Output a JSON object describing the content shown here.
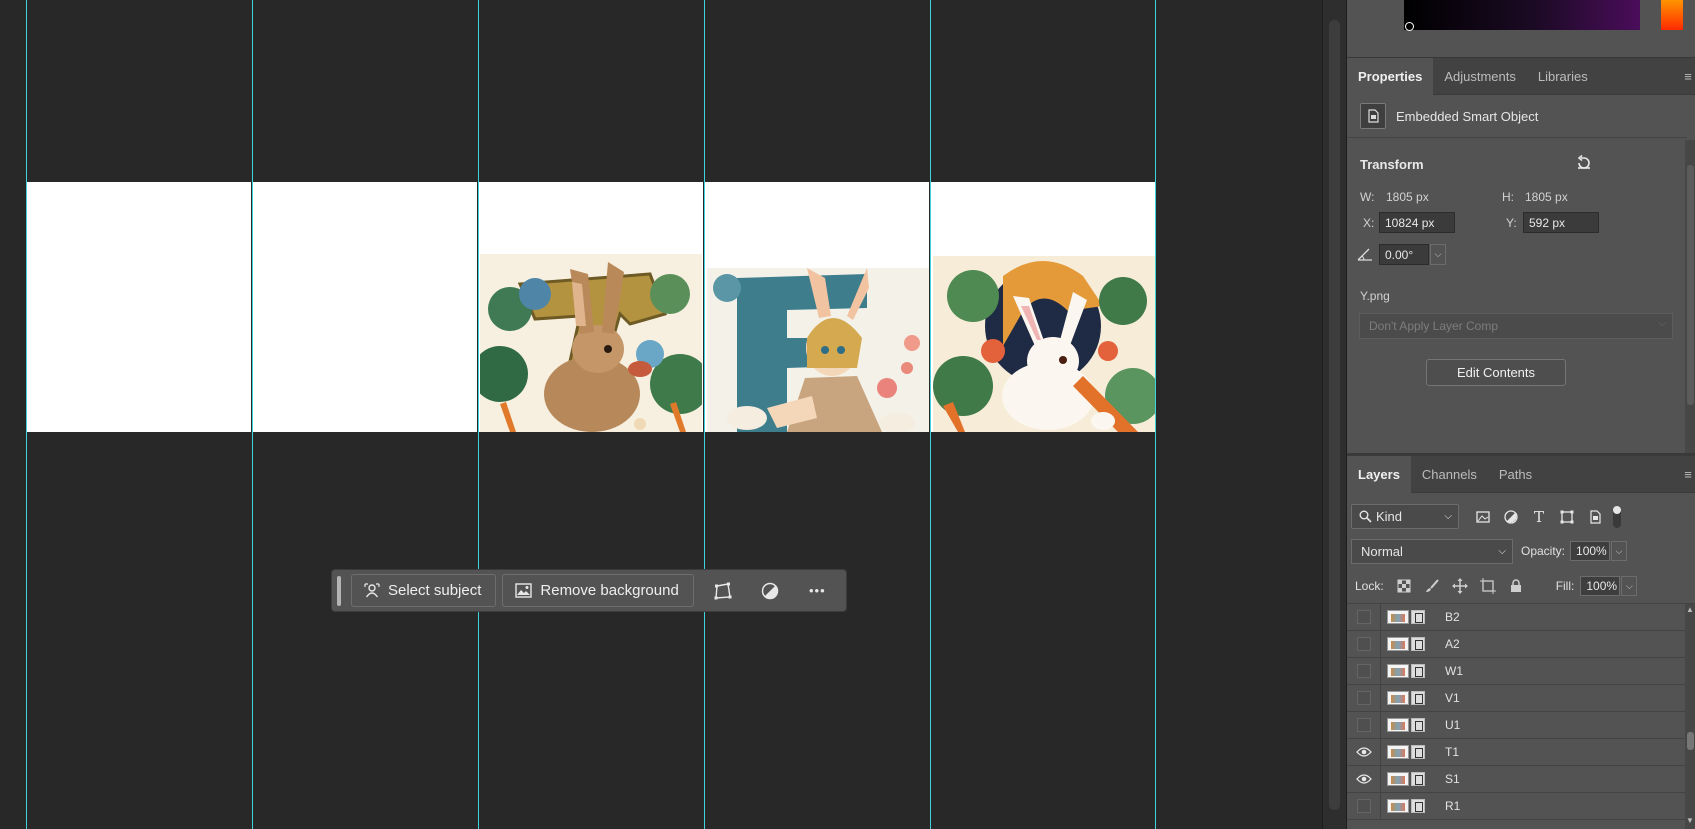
{
  "taskbar": {
    "select_subject": "Select subject",
    "remove_background": "Remove background",
    "more_label": "•••"
  },
  "properties_tabs": [
    {
      "label": "Properties",
      "active": true
    },
    {
      "label": "Adjustments",
      "active": false
    },
    {
      "label": "Libraries",
      "active": false
    }
  ],
  "properties": {
    "object_type": "Embedded Smart Object",
    "transform_heading": "Transform",
    "w_label": "W:",
    "w_value": "1805 px",
    "h_label": "H:",
    "h_value": "1805 px",
    "x_label": "X:",
    "x_value": "10824 px",
    "y_label": "Y:",
    "y_value": "592 px",
    "angle_value": "0.00°",
    "file_name": "Y.png",
    "layer_comp": "Don't Apply Layer Comp",
    "edit_contents": "Edit Contents"
  },
  "layers_tabs": [
    {
      "label": "Layers",
      "active": true
    },
    {
      "label": "Channels",
      "active": false
    },
    {
      "label": "Paths",
      "active": false
    }
  ],
  "layers_panel": {
    "filter_kind": "Kind",
    "blend_mode": "Normal",
    "opacity_label": "Opacity:",
    "opacity_value": "100%",
    "lock_label": "Lock:",
    "fill_label": "Fill:",
    "fill_value": "100%"
  },
  "layers": [
    {
      "name": "B2",
      "visible": false
    },
    {
      "name": "A2",
      "visible": false
    },
    {
      "name": "W1",
      "visible": false
    },
    {
      "name": "V1",
      "visible": false
    },
    {
      "name": "U1",
      "visible": false
    },
    {
      "name": "T1",
      "visible": true
    },
    {
      "name": "S1",
      "visible": true
    },
    {
      "name": "R1",
      "visible": false
    }
  ],
  "colors": {
    "guide": "#3fd4dd",
    "canvas_bg": "#282828",
    "panel_bg": "#535353"
  },
  "icons": {
    "select_subject": "person-select-icon",
    "remove_background": "image-icon",
    "transform": "transform-icon",
    "adjust": "half-circle-icon",
    "more": "more-dots-icon",
    "reset": "reset-icon",
    "eye": "eye-icon"
  }
}
